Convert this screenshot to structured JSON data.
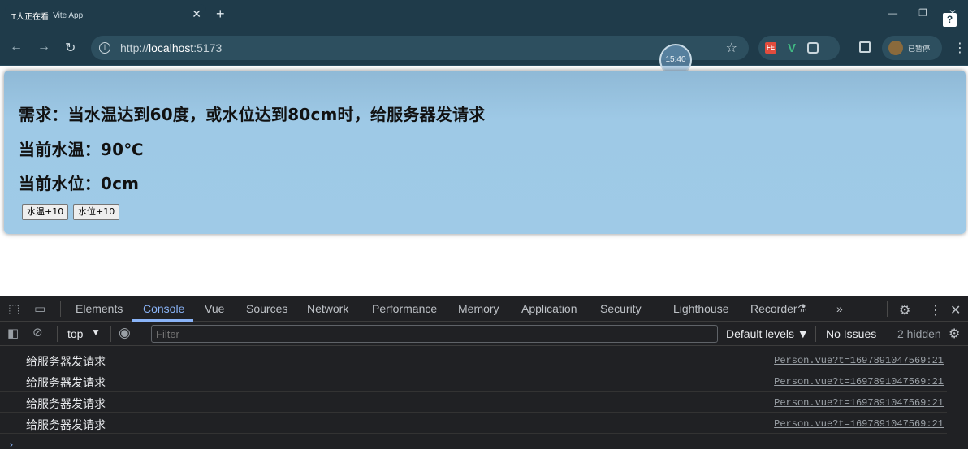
{
  "browser": {
    "tab_prefix": "T人正在看",
    "tab_title": "Vite App",
    "tab_close": "✕",
    "new_tab": "+",
    "url_prefix": "http://",
    "url_host": "localhost",
    "url_port": ":5173",
    "profile_label": "已暂停",
    "timer": "15:40",
    "help_badge": "?"
  },
  "page": {
    "requirement": "需求：当水温达到60度，或水位达到80cm时，给服务器发请求",
    "temp_line": "当前水温：90℃",
    "level_line": "当前水位：0cm",
    "btn_temp": "水温+10",
    "btn_level": "水位+10"
  },
  "devtools": {
    "tabs": [
      "Elements",
      "Console",
      "Vue",
      "Sources",
      "Network",
      "Performance",
      "Memory",
      "Application",
      "Security",
      "Lighthouse",
      "Recorder"
    ],
    "context": "top",
    "filter_placeholder": "Filter",
    "default_levels": "Default levels ▼",
    "no_issues": "No Issues",
    "hidden": "2 hidden",
    "logs": [
      {
        "msg": "给服务器发请求",
        "src": "Person.vue?t=1697891047569:21"
      },
      {
        "msg": "给服务器发请求",
        "src": "Person.vue?t=1697891047569:21"
      },
      {
        "msg": "给服务器发请求",
        "src": "Person.vue?t=1697891047569:21"
      },
      {
        "msg": "给服务器发请求",
        "src": "Person.vue?t=1697891047569:21"
      }
    ]
  }
}
